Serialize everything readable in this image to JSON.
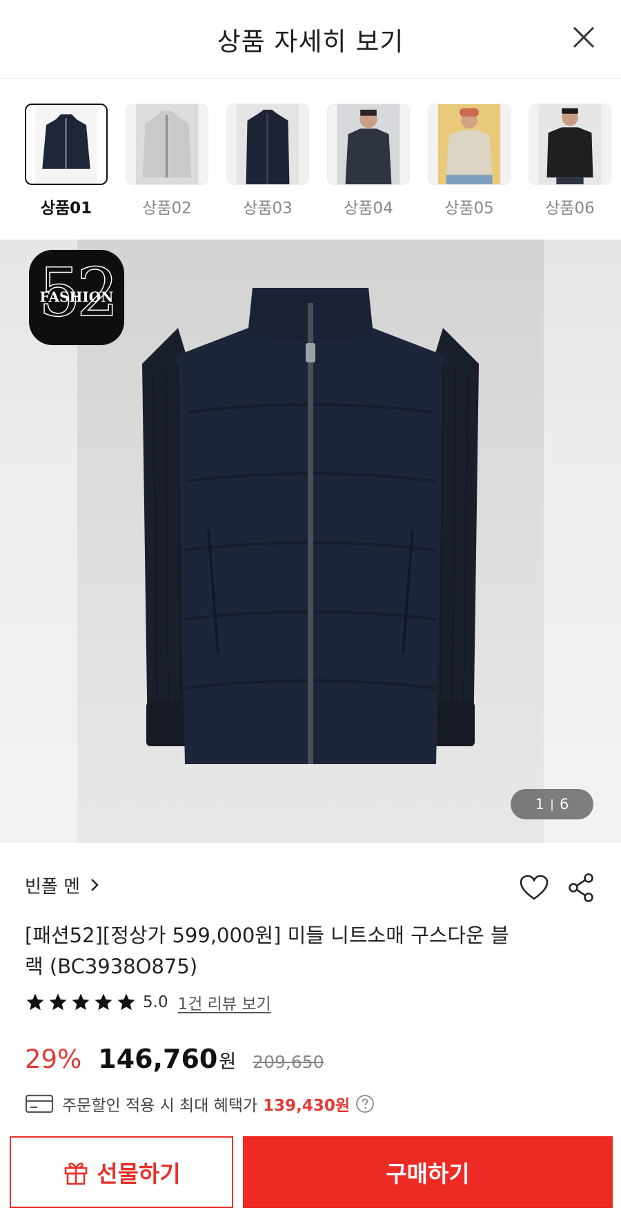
{
  "header": {
    "title": "상품 자세히 보기"
  },
  "thumbnails": [
    {
      "label": "상품01",
      "active": true
    },
    {
      "label": "상품02",
      "active": false
    },
    {
      "label": "상품03",
      "active": false
    },
    {
      "label": "상품04",
      "active": false
    },
    {
      "label": "상품05",
      "active": false
    },
    {
      "label": "상품06",
      "active": false
    }
  ],
  "hero": {
    "logo_number": "52",
    "logo_word": "FASHION",
    "pager_current": "1",
    "pager_total": "6"
  },
  "product": {
    "brand": "빈폴 멘",
    "title": "[패션52][정상가 599,000원] 미들 니트소매 구스다운 블랙 (BC3938O875)",
    "rating_value": "5.0",
    "rating_stars": 5,
    "review_link": "1건 리뷰 보기",
    "discount": "29%",
    "price": "146,760",
    "currency": "원",
    "original_price": "209,650",
    "benefit_text": "주문할인 적용 시 최대 혜택가",
    "benefit_amount": "139,430원"
  },
  "buttons": {
    "gift": "선물하기",
    "buy": "구매하기"
  },
  "colors": {
    "accent": "#e8302a",
    "discount": "#e53935"
  }
}
